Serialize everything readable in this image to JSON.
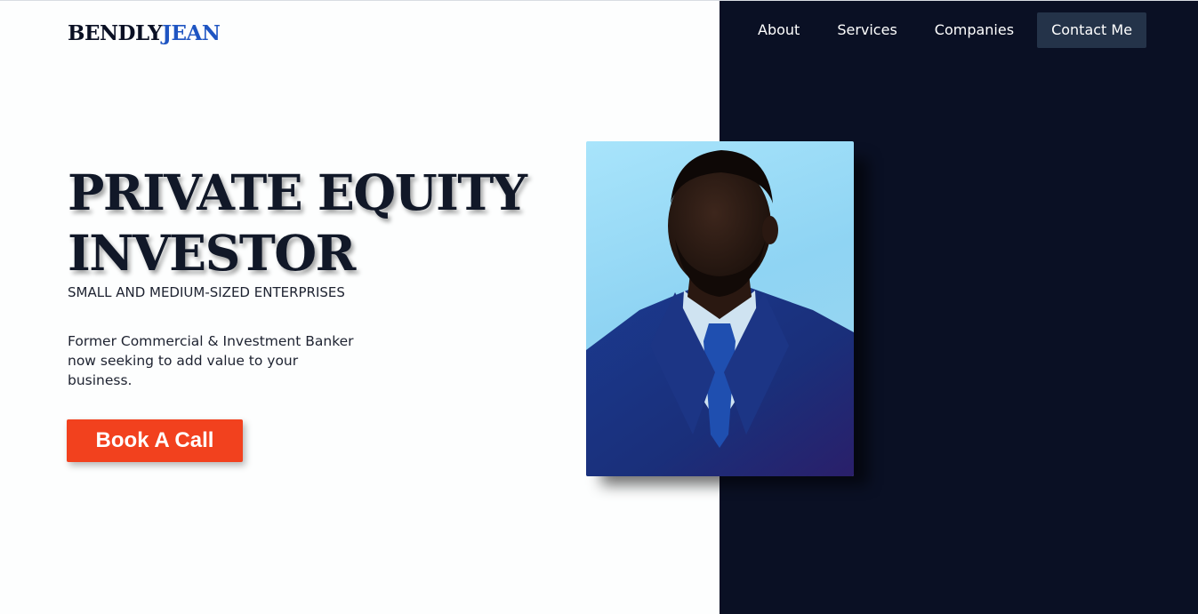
{
  "header": {
    "logo_first": "BENDLY",
    "logo_last": "JEAN",
    "nav": [
      "About",
      "Services",
      "Companies"
    ],
    "contact_label": "Contact Me"
  },
  "hero": {
    "headline_line1": "PRIVATE EQUITY",
    "headline_line2": "INVESTOR",
    "subheading": "SMALL AND MEDIUM-SIZED ENTERPRISES",
    "intro_line1": "Former Commercial & Investment Banker",
    "intro_line2": "now seeking to add value to your",
    "intro_line3": "business.",
    "cta_label": "Book A Call"
  },
  "colors": {
    "dark_panel": "#0a1024",
    "logo_accent": "#1f55c2",
    "cta": "#f2411e",
    "contact_button": "#243349"
  },
  "portrait": {
    "icon": "portrait-photo"
  }
}
